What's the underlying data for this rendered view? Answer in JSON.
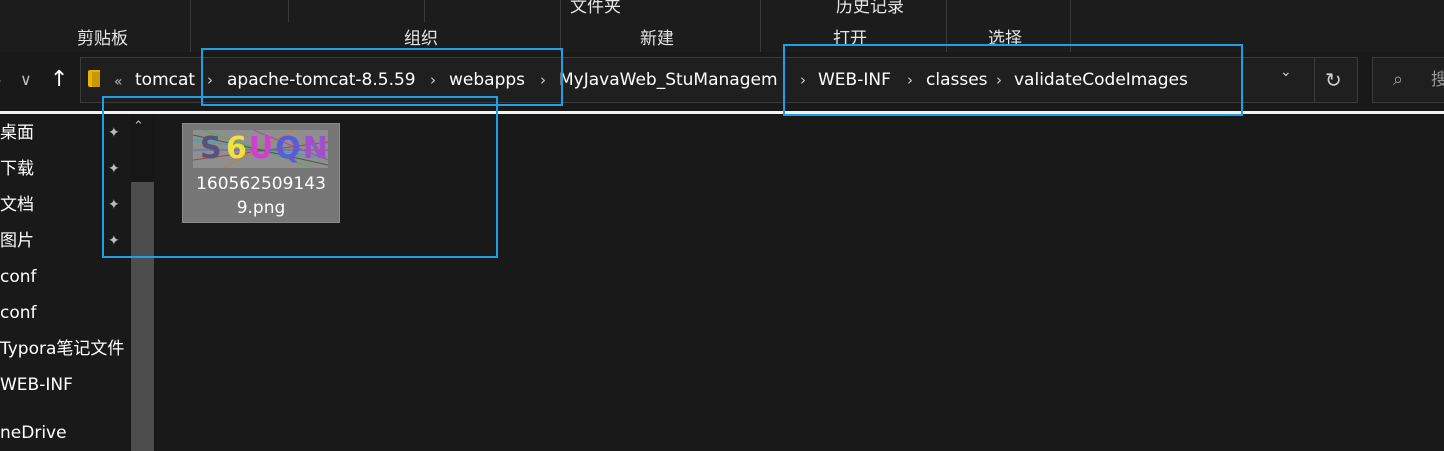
{
  "ribbon": {
    "top_partial": [
      "文件夹",
      "历史记录"
    ],
    "groups": [
      "剪贴板",
      "组织",
      "新建",
      "打开",
      "选择"
    ]
  },
  "nav": {
    "back": "←",
    "forward": "›",
    "recent": "∨",
    "up": "↑"
  },
  "address": {
    "overflow": "«",
    "crumbs": [
      "tomcat",
      "apache-tomcat-8.5.59",
      "webapps",
      "MyJavaWeb_StuManagem",
      "WEB-INF",
      "classes",
      "validateCodeImages"
    ],
    "separator": "›",
    "dropdown": "⌄",
    "refresh": "↻"
  },
  "search": {
    "icon": "⌕",
    "placeholder": "搜"
  },
  "sidebar": {
    "items": [
      "桌面",
      "下载",
      "文档",
      "图片",
      "conf",
      "conf",
      "Typora笔记文件",
      "WEB-INF",
      "neDrive"
    ],
    "pin": "📌",
    "scroll_up": "⌃"
  },
  "files": [
    {
      "name_line1": "160562509143",
      "name_line2": "9.png",
      "captcha_text": "6UQN",
      "captcha_lead": "S"
    }
  ],
  "colors": {
    "background": "#191919",
    "annotation": "#1ea0e6",
    "selected_tile": "#777777",
    "folder": "#e8b400"
  }
}
